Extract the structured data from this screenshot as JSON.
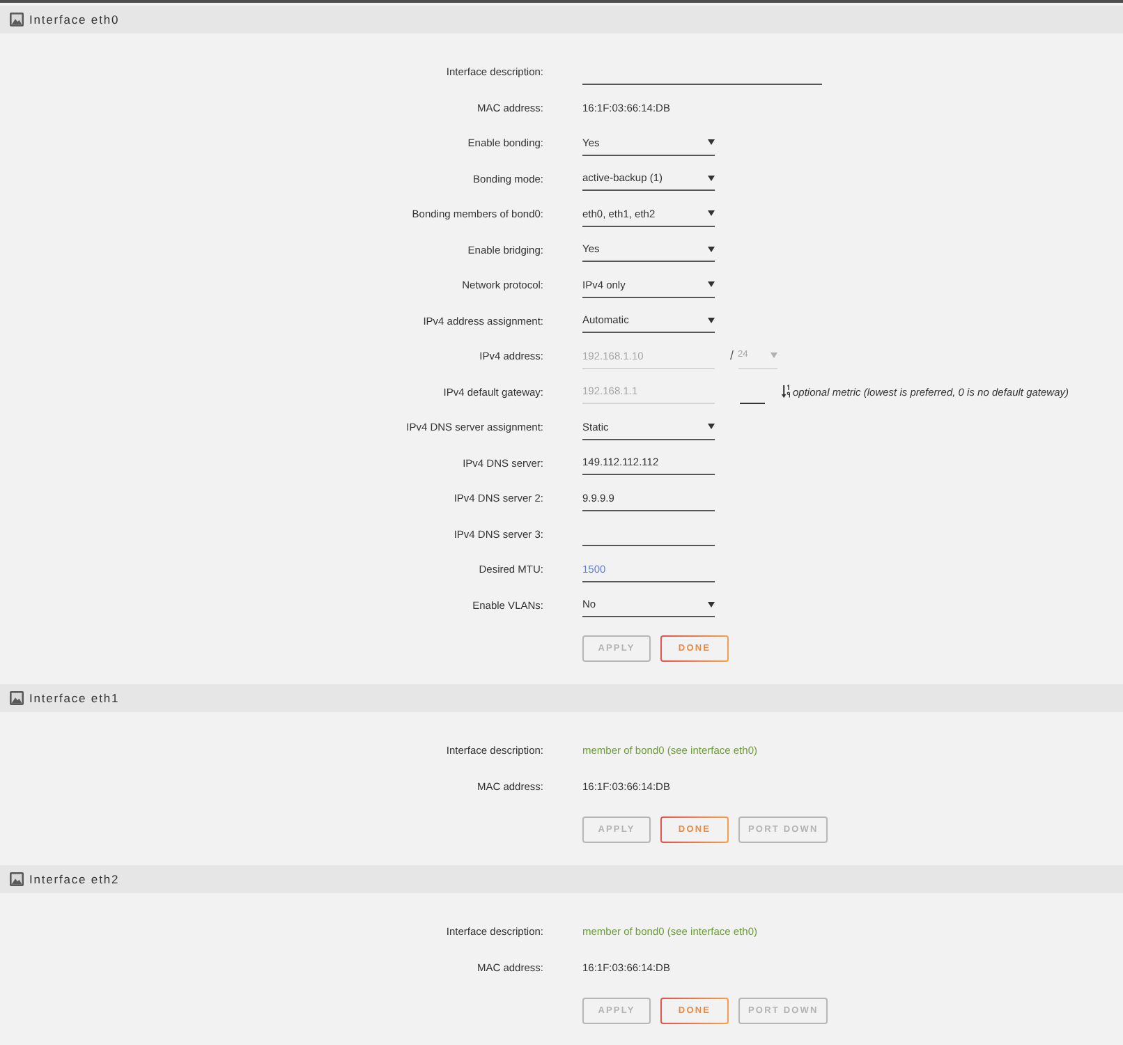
{
  "sections": [
    {
      "title": "Interface eth0",
      "fields": [
        {
          "label": "Interface description:",
          "kind": "longtext",
          "disabled": false
        },
        {
          "label": "MAC address:",
          "kind": "static",
          "value": "16:1F:03:66:14:DB"
        },
        {
          "label": "Enable bonding:",
          "kind": "select",
          "value": "Yes",
          "disabled": false
        },
        {
          "label": "Bonding mode:",
          "kind": "select",
          "value": "active-backup (1)",
          "disabled": false
        },
        {
          "label": "Bonding members of bond0:",
          "kind": "select",
          "value": "eth0, eth1, eth2",
          "disabled": false
        },
        {
          "label": "Enable bridging:",
          "kind": "select",
          "value": "Yes",
          "disabled": false
        },
        {
          "label": "Network protocol:",
          "kind": "select",
          "value": "IPv4 only",
          "disabled": false
        },
        {
          "label": "IPv4 address assignment:",
          "kind": "select",
          "value": "Automatic",
          "disabled": false
        },
        {
          "label": "IPv4 address:",
          "kind": "input",
          "value": "192.168.1.10",
          "disabled": true,
          "prefix": {
            "separator": "/",
            "value": "24",
            "disabled": true
          }
        },
        {
          "label": "IPv4 default gateway:",
          "kind": "input",
          "value": "192.168.1.1",
          "disabled": true,
          "metric": {
            "hint": "optional metric (lowest is preferred, 0 is no default gateway)"
          }
        },
        {
          "label": "IPv4 DNS server assignment:",
          "kind": "select",
          "value": "Static",
          "disabled": false
        },
        {
          "label": "IPv4 DNS server:",
          "kind": "input",
          "value": "149.112.112.112",
          "disabled": false
        },
        {
          "label": "IPv4 DNS server 2:",
          "kind": "input",
          "value": "9.9.9.9",
          "disabled": false
        },
        {
          "label": "IPv4 DNS server 3:",
          "kind": "input",
          "disabled": false
        },
        {
          "label": "Desired MTU:",
          "kind": "input",
          "placeholder": "1500",
          "disabled": false
        },
        {
          "label": "Enable VLANs:",
          "kind": "select",
          "value": "No",
          "disabled": false
        }
      ],
      "buttons": [
        {
          "label": "APPLY",
          "kind": "plain",
          "disabled": true
        },
        {
          "label": "DONE",
          "kind": "accent",
          "disabled": false
        }
      ]
    },
    {
      "title": "Interface eth1",
      "fields": [
        {
          "label": "Interface description:",
          "kind": "note",
          "value": "member of bond0 (see interface eth0)"
        },
        {
          "label": "MAC address:",
          "kind": "static",
          "value": "16:1F:03:66:14:DB"
        }
      ],
      "buttons": [
        {
          "label": "APPLY",
          "kind": "plain",
          "disabled": true
        },
        {
          "label": "DONE",
          "kind": "accent",
          "disabled": false
        },
        {
          "label": "PORT DOWN",
          "kind": "plain",
          "disabled": true
        }
      ]
    },
    {
      "title": "Interface eth2",
      "fields": [
        {
          "label": "Interface description:",
          "kind": "note",
          "value": "member of bond0 (see interface eth0)"
        },
        {
          "label": "MAC address:",
          "kind": "static",
          "value": "16:1F:03:66:14:DB"
        }
      ],
      "buttons": [
        {
          "label": "APPLY",
          "kind": "plain",
          "disabled": true
        },
        {
          "label": "DONE",
          "kind": "accent",
          "disabled": false
        },
        {
          "label": "PORT DOWN",
          "kind": "plain",
          "disabled": true
        }
      ]
    }
  ]
}
